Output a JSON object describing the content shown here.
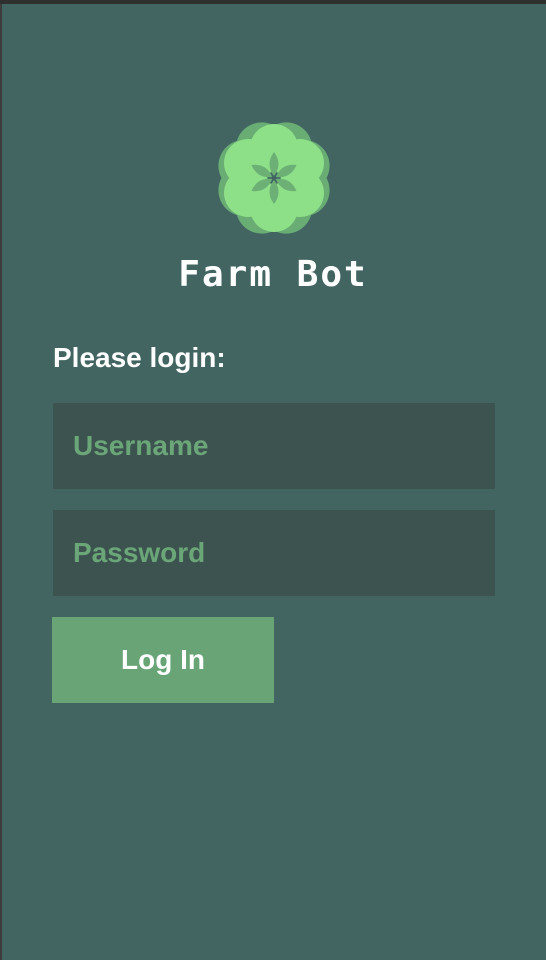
{
  "app": {
    "title": "Farm Bot",
    "logo_icon": "flower-logo-icon"
  },
  "login": {
    "prompt": "Please login:",
    "username_placeholder": "Username",
    "username_value": "",
    "password_placeholder": "Password",
    "password_value": "",
    "submit_label": "Log In"
  },
  "colors": {
    "background": "#426562",
    "field_background": "#3d5350",
    "accent": "#68a476",
    "logo_light": "#8ee088",
    "logo_dark": "#6cb076",
    "text": "#ffffff"
  }
}
